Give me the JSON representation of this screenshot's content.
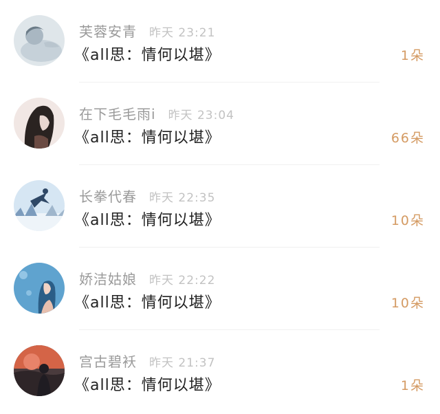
{
  "items": [
    {
      "name": "芙蓉安青",
      "time": "昨天 23:21",
      "title": "《all思：情何以堪》",
      "amount": "1朵",
      "avatar_icon": "sleeping-boy-avatar",
      "colors": [
        "#dfe6ea",
        "#a9b7c2",
        "#6c7c88"
      ]
    },
    {
      "name": "在下毛毛雨i",
      "time": "昨天 23:04",
      "title": "《all思：情何以堪》",
      "amount": "66朵",
      "avatar_icon": "long-hair-boy-avatar",
      "colors": [
        "#f1e7e4",
        "#2a2321",
        "#6a4a42"
      ]
    },
    {
      "name": "长拳代春",
      "time": "昨天 22:35",
      "title": "《all思：情何以堪》",
      "amount": "10朵",
      "avatar_icon": "winter-jump-avatar",
      "colors": [
        "#d6e6f3",
        "#7c9cbd",
        "#2f4866"
      ]
    },
    {
      "name": "娇洁姑娘",
      "time": "昨天 22:22",
      "title": "《all思：情何以堪》",
      "amount": "10朵",
      "avatar_icon": "girl-blue-avatar",
      "colors": [
        "#5fa3cf",
        "#2b5e87",
        "#f1d3c5"
      ]
    },
    {
      "name": "宫古碧袄",
      "time": "昨天 21:37",
      "title": "《all思：情何以堪》",
      "amount": "1朵",
      "avatar_icon": "sunset-figure-avatar",
      "colors": [
        "#d46447",
        "#4a3b3d",
        "#1f1c22"
      ]
    }
  ]
}
